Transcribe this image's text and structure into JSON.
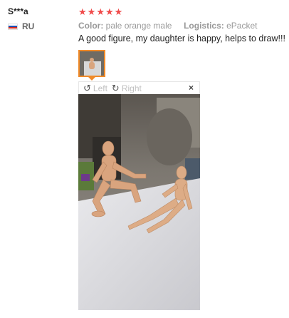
{
  "reviewer": {
    "name": "S***a",
    "country": "RU",
    "flag_colors": [
      "#ffffff",
      "#1e50b4",
      "#d52b1e"
    ]
  },
  "rating": {
    "stars": 5,
    "max": 5,
    "color": "#f04a4a"
  },
  "attributes": {
    "color_key": "Color:",
    "color_value": "pale orange male",
    "logistics_key": "Logistics:",
    "logistics_value": "ePacket"
  },
  "review": {
    "text": "A good figure, my daughter is happy, helps to draw!!!"
  },
  "viewer": {
    "rotate_left_label": "Left",
    "rotate_right_label": "Right",
    "close_label": "×",
    "rotate_left_icon": "rotate-left-icon",
    "rotate_right_icon": "rotate-right-icon",
    "accent_color": "#f08a28"
  }
}
